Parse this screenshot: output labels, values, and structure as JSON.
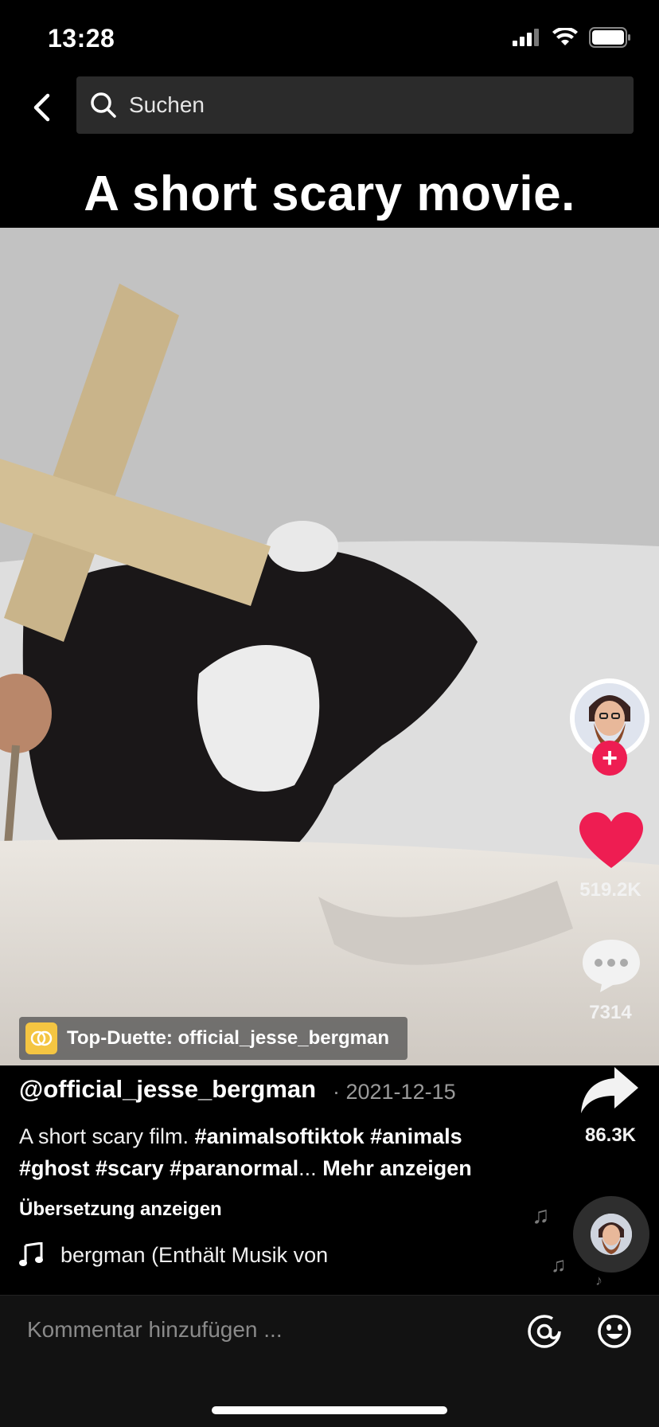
{
  "status_bar": {
    "time": "13:28"
  },
  "header": {
    "search_placeholder": "Suchen"
  },
  "video": {
    "caption": "A short scary movie."
  },
  "actions": {
    "likes": "519.2K",
    "comments": "7314",
    "shares": "86.3K"
  },
  "duet": {
    "label": "Top-Duette: official_jesse_bergman"
  },
  "post": {
    "username": "@official_jesse_bergman",
    "date": "· 2021-12-15",
    "description_text": "A short scary film. ",
    "hashtags_line1": "#animalsoftiktok #animals",
    "hashtags_line2": "#ghost #scary #paranormal",
    "ellipsis": "... ",
    "more_label": "Mehr anzeigen",
    "translate_label": "Übersetzung anzeigen",
    "music": "bergman (Enthält Musik von"
  },
  "comment_bar": {
    "placeholder": "Kommentar hinzufügen ..."
  },
  "colors": {
    "accent": "#ee1d52",
    "duet_badge": "#f4c542",
    "background": "#000000"
  }
}
